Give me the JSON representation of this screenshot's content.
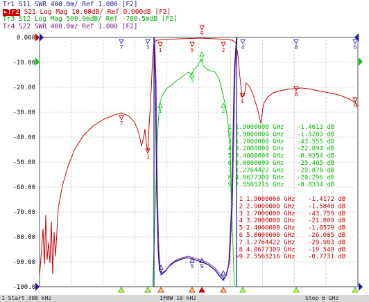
{
  "traces": [
    {
      "id": "Tr1",
      "label": "S11",
      "format": "SWR",
      "scale": "400.0m/",
      "ref": "Ref 1.000",
      "channel": "[F2]",
      "color": "#1a1a99",
      "active": false
    },
    {
      "id": "Tr2",
      "label": "S21",
      "format": "Log Mag",
      "scale": "10.00dB/",
      "ref": "Ref 0.000dB",
      "channel": "[F2]",
      "color": "#cc0000",
      "active": true
    },
    {
      "id": "Tr3",
      "label": "S12",
      "format": "Log Mag",
      "scale": "500.0mdB/",
      "ref": "Ref -780.5mdB",
      "channel": "[F2]",
      "color": "#00aa00",
      "active": false
    },
    {
      "id": "Tr4",
      "label": "S22",
      "format": "SWR",
      "scale": "400.0m/",
      "ref": "Ref 1.000",
      "channel": "[F2]",
      "color": "#7a1a8a",
      "active": false
    }
  ],
  "y_axis_labels": [
    "0.000",
    "-10.00",
    "-20.00",
    "-30.00",
    "-40.00",
    "-50.00",
    "-60.00",
    "-70.00",
    "-80.00",
    "-90.00",
    "-100.0"
  ],
  "marker_table_green": [
    {
      "n": "1",
      "freq": "1.9000000 GHz",
      "val": "-1.4613 dB"
    },
    {
      "n": "2",
      "freq": "2.9000000 GHz",
      "val": "-1.5283 dB"
    },
    {
      "n": "3",
      "freq": "1.7000000 GHz",
      "val": "-43.555 dB"
    },
    {
      "n": "4",
      "freq": "3.2000000 GHz",
      "val": "-22.894 dB"
    },
    {
      "n": "5",
      "freq": "2.4000000 GHz",
      "val": "-0.9354 dB"
    },
    {
      "n": "6",
      "freq": "5.0000000 GHz",
      "val": "-25.465 dB"
    },
    {
      "n": "7",
      "freq": "1.2764422 GHz",
      "val": "-29.878 dB"
    },
    {
      "n": "8",
      "freq": "4.0677309 GHz",
      "val": "-20.296 dB"
    },
    {
      "n": "9",
      "freq": "2.5565216 GHz",
      "val": "-0.8334 dB"
    }
  ],
  "marker_table_red": [
    {
      "n": "1",
      "freq": "1.9000000 GHz",
      "val": "-1.4172 dB"
    },
    {
      "n": "2",
      "freq": "2.9000000 GHz",
      "val": "-1.5848 dB"
    },
    {
      "n": "3",
      "freq": "1.7000000 GHz",
      "val": "-43.759 dB"
    },
    {
      "n": "4",
      "freq": "3.2000000 GHz",
      "val": "-21.809 dB"
    },
    {
      "n": "5",
      "freq": "2.4000000 GHz",
      "val": "-1.0579 dB"
    },
    {
      "n": "6",
      "freq": "5.0000000 GHz",
      "val": "-26.085 dB"
    },
    {
      "n": "7",
      "freq": "1.2764422 GHz",
      "val": "-29.903 dB"
    },
    {
      "n": "8",
      "freq": "4.0677309 GHz",
      "val": "-19.548 dB"
    },
    {
      "n": ">9",
      "freq": "2.5565216 GHz",
      "val": "-0.7731 dB"
    }
  ],
  "status": {
    "start": "1 Start 300 kHz",
    "ifbw": "IFBW 10 kHz",
    "stop": "Stop 6 GHz"
  },
  "colors": {
    "s21": "#cc0000",
    "s12": "#00cc00",
    "s11": "#1a1a99",
    "s22": "#8a2aa8",
    "grid": "#a8a8a8",
    "marker_arrow": "#3333cc"
  }
}
